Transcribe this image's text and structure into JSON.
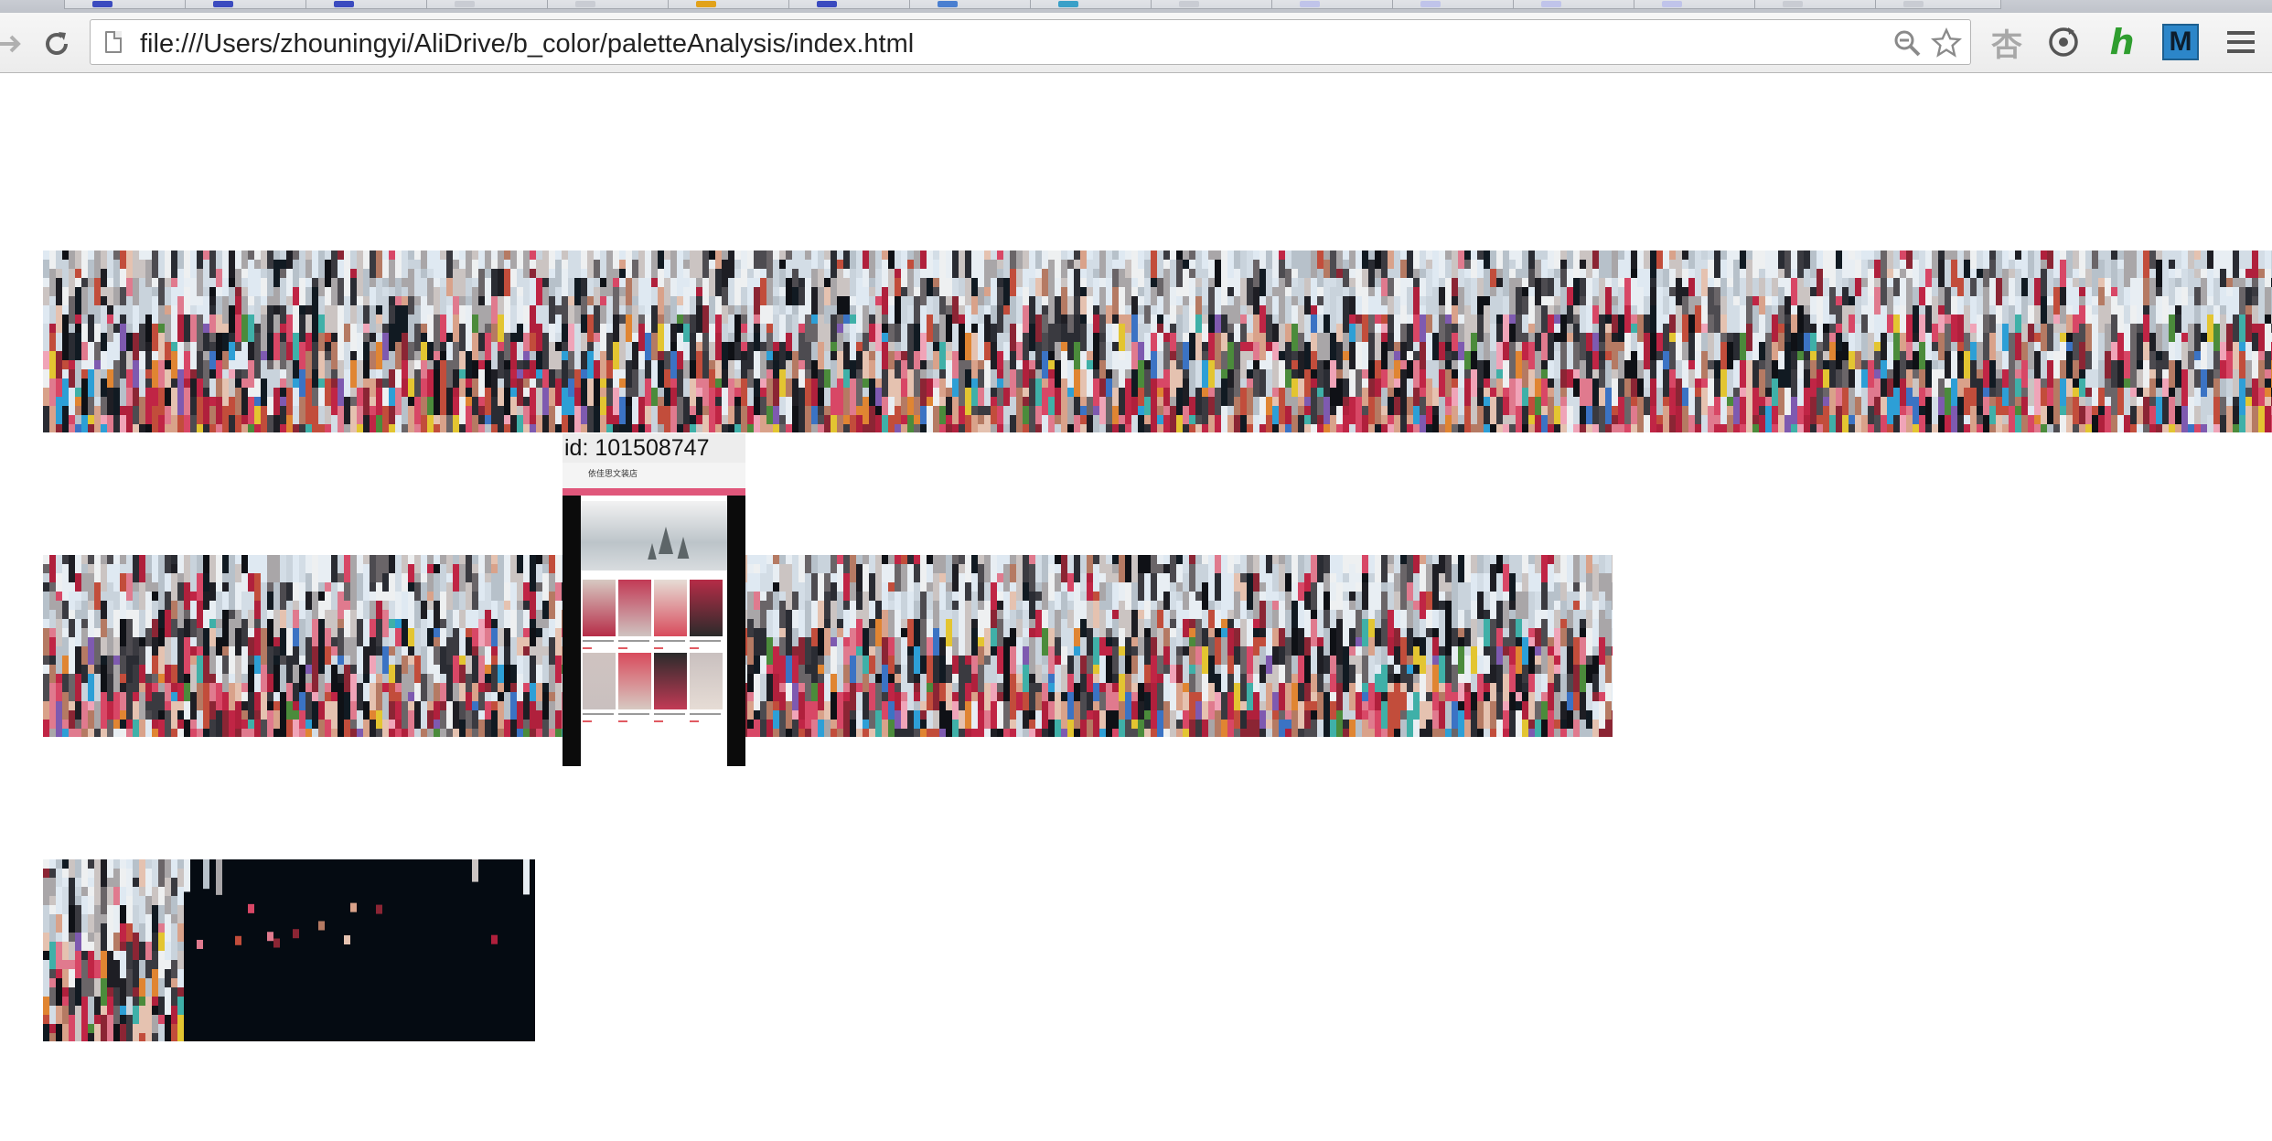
{
  "browser": {
    "url": "file:///Users/zhouningyi/AliDrive/b_color/paletteAnalysis/index.html",
    "nav": {
      "forward_icon": "forward-arrow-icon",
      "reload_icon": "reload-icon"
    },
    "omnibox_icons": [
      "zoom-icon",
      "bookmark-star-icon"
    ],
    "extensions": [
      {
        "name": "translate-extension-icon",
        "glyph": "杏",
        "color": "#9a9a9a"
      },
      {
        "name": "sync-extension-icon",
        "glyph": "⟳",
        "color": "#555555"
      },
      {
        "name": "h-extension-icon",
        "glyph": "h",
        "color": "#3aa335"
      },
      {
        "name": "m-extension-icon",
        "glyph": "M",
        "color": "#2a7fc0"
      },
      {
        "name": "menu-icon",
        "glyph": "≡",
        "color": "#555555"
      }
    ],
    "tab_favicon_colors": [
      "#3b4bbf",
      "#3b4bbf",
      "#3b4bbf",
      "#c9ccd3",
      "#c9ccd3",
      "#e2a21a",
      "#3b4bbf",
      "#4a7fd0",
      "#3aa0c8",
      "#c9ccd3",
      "#c0c4ea",
      "#c0c4ea",
      "#c0c4ea",
      "#c0c4ea",
      "#c9ccd3",
      "#c9ccd3"
    ]
  },
  "content": {
    "hover_popup": {
      "label": "id: 101508747",
      "thumbnail_shop_name": "依佳思文装店"
    },
    "strip_palette": {
      "light": [
        "#dfe9f2",
        "#e8eef3",
        "#d3dde6",
        "#c9d3dc",
        "#b7c1ca",
        "#eef0f1",
        "#cbc4c2",
        "#a9a6a8"
      ],
      "dark": [
        "#1e1e24",
        "#2a2c33",
        "#0f1116",
        "#3a3a40",
        "#4d4b50",
        "#6a6568",
        "#111a22"
      ],
      "warm": [
        "#c02545",
        "#b0203c",
        "#d84766",
        "#e07a8e",
        "#8b2534",
        "#c24d3b",
        "#d9a28a",
        "#b57a63",
        "#e5c2b0"
      ],
      "accent": [
        "#e3c531",
        "#3b73c4",
        "#3fb0a8",
        "#7e5ab0",
        "#e08532",
        "#4b8b3b",
        "#f0a4b8",
        "#2d9fd6"
      ],
      "night": "#050b12"
    }
  }
}
